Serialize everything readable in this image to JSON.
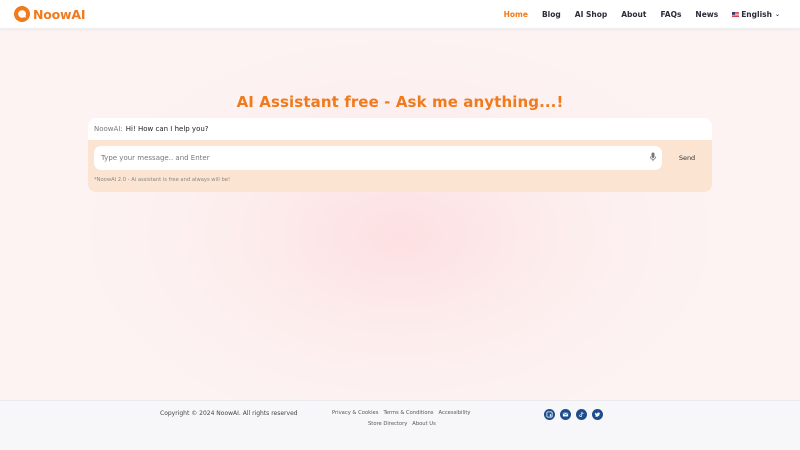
{
  "brand": {
    "name": "NoowAI",
    "accent": "#f07a1c"
  },
  "nav": {
    "items": [
      {
        "label": "Home",
        "active": true
      },
      {
        "label": "Blog"
      },
      {
        "label": "AI Shop"
      },
      {
        "label": "About"
      },
      {
        "label": "FAQs"
      },
      {
        "label": "News"
      }
    ],
    "language": "English"
  },
  "main": {
    "title": "AI Assistant free - Ask me anything...!",
    "message": {
      "sender": "NoowAI:",
      "text": "Hi! How can I help you?"
    },
    "input": {
      "placeholder": "Type your message.. and Enter",
      "value": ""
    },
    "send_label": "Send",
    "note": "*NoowAI 2.0 - Ai assistant is free and always will be!"
  },
  "footer": {
    "copyright": "Copyright © 2024 NoowAI. All rights reserved",
    "links_row1": [
      "Privacy & Cookies",
      "Terms & Conditions",
      "Accessibility"
    ],
    "links_row2": [
      "Store Directory",
      "About Us"
    ],
    "socials": [
      "facebook-icon",
      "email-icon",
      "tiktok-icon",
      "twitter-icon"
    ],
    "social_color": "#1e4d8c"
  }
}
